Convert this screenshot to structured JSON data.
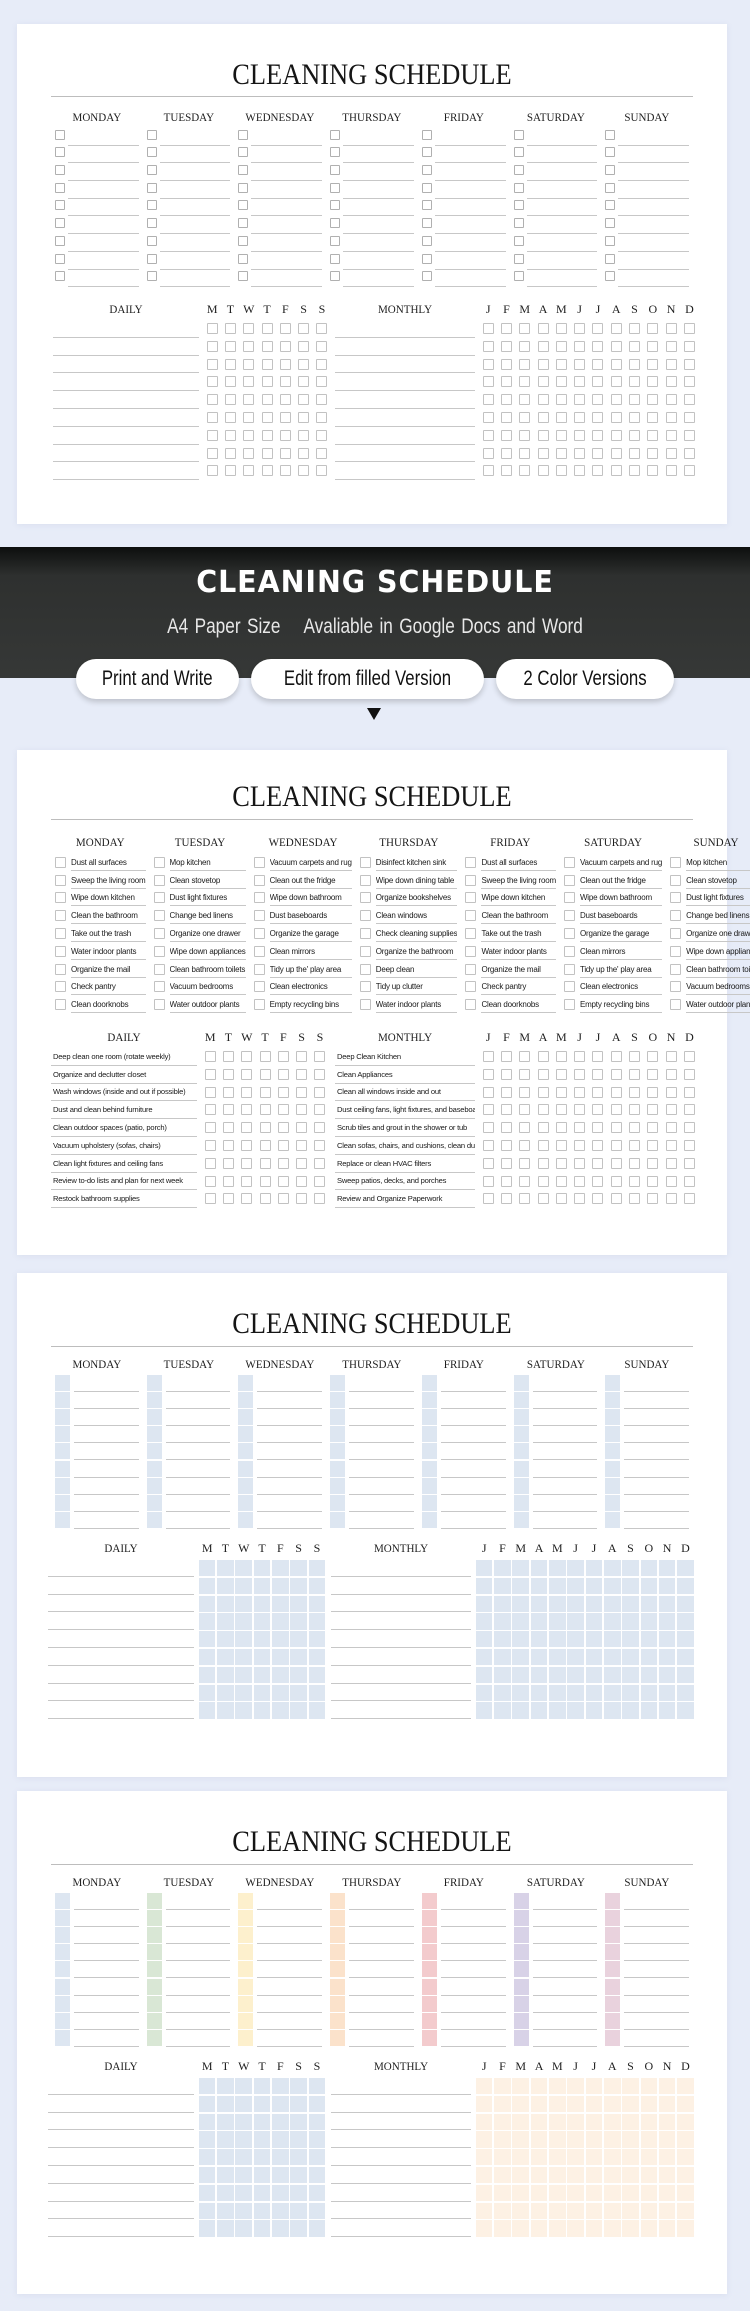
{
  "title": "CLEANING SCHEDULE",
  "days": [
    "MONDAY",
    "TUESDAY",
    "WEDNESDAY",
    "THURSDAY",
    "FRIDAY",
    "SATURDAY",
    "SUNDAY"
  ],
  "daily_header": "DAILY",
  "monthly_header": "MONTHLY",
  "week_letters": [
    "M",
    "T",
    "W",
    "T",
    "F",
    "S",
    "S"
  ],
  "month_letters": [
    "J",
    "F",
    "M",
    "A",
    "M",
    "J",
    "J",
    "A",
    "S",
    "O",
    "N",
    "D"
  ],
  "rows_per_section": 9,
  "banner": {
    "title": "CLEANING SCHEDULE",
    "subtitle_left": "A4 Paper Size",
    "subtitle_right": "Avaliable in Google Docs and Word",
    "pills": [
      "Print and Write",
      "Edit from filled Version",
      "2 Color Versions"
    ]
  },
  "filled_version": {
    "weekly_tasks": [
      [
        "Dust all surfaces",
        "Sweep the living room",
        "Wipe down kitchen",
        "Clean the bathroom",
        "Take out the trash",
        "Water indoor plants",
        "Organize the mail",
        "Check pantry",
        "Clean doorknobs"
      ],
      [
        "Mop kitchen",
        "Clean stovetop",
        "Dust light fixtures",
        "Change bed linens",
        "Organize one drawer",
        "Wipe down appliances",
        "Clean bathroom toilets",
        "Vacuum bedrooms",
        "Water outdoor plants"
      ],
      [
        "Vacuum carpets and rug",
        "Clean out the fridge",
        "Wipe down bathroom",
        "Dust baseboards",
        "Organize the garage",
        "Clean mirrors",
        "Tidy up the' play area",
        "Clean electronics",
        "Empty recycling bins"
      ],
      [
        "Disinfect kitchen sink",
        "Wipe down dining table",
        "Organize bookshelves",
        "Clean windows",
        "Check cleaning supplies",
        "Organize the bathroom",
        "Deep clean",
        "Tidy up clutter",
        "Water indoor plants"
      ],
      [
        "Dust all surfaces",
        "Sweep the living room",
        "Wipe down kitchen",
        "Clean the bathroom",
        "Take out the trash",
        "Water indoor plants",
        "Organize the mail",
        "Check pantry",
        "Clean doorknobs"
      ],
      [
        "Vacuum carpets and rug",
        "Clean out the fridge",
        "Wipe down bathroom",
        "Dust baseboards",
        "Organize the garage",
        "Clean mirrors",
        "Tidy up the' play area",
        "Clean electronics",
        "Empty recycling bins"
      ],
      [
        "Mop kitchen",
        "Clean stovetop",
        "Dust light fixtures",
        "Change bed linens",
        "Organize one drawer",
        "Wipe down appliances",
        "Clean bathroom toilets",
        "Vacuum bedrooms",
        "Water outdoor plants"
      ]
    ],
    "daily_tasks": [
      "Deep clean one room (rotate weekly)",
      "Organize and declutter closet",
      "Wash windows (inside and out if possible)",
      "Dust and clean behind furniture",
      "Clean outdoor spaces (patio, porch)",
      "Vacuum upholstery (sofas, chairs)",
      "Clean light fixtures and ceiling fans",
      "Review to-do lists and plan for next week",
      "Restock bathroom supplies"
    ],
    "monthly_tasks": [
      "Deep Clean Kitchen",
      "Clean Appliances",
      "Clean all windows inside and out",
      "Dust ceiling fans, light fixtures, and baseboards",
      "Scrub tiles and grout in the shower or tub",
      "Clean sofas, chairs, and cushions, clean  dust",
      "Replace or clean HVAC filters",
      "Sweep patios, decks, and porches",
      "Review and Organize Paperwork"
    ]
  },
  "colors": {
    "blue_version": "#dde6f1",
    "day_colors": [
      "#dde6f1",
      "#d9e7d5",
      "#fdf0cd",
      "#fbe2cb",
      "#f3cbcd",
      "#d8d2e7",
      "#e9d2dd"
    ],
    "daily_grid_color": "#dde6f1",
    "monthly_grid_color": "#fdf1e4",
    "banner_bg": "#363837"
  }
}
